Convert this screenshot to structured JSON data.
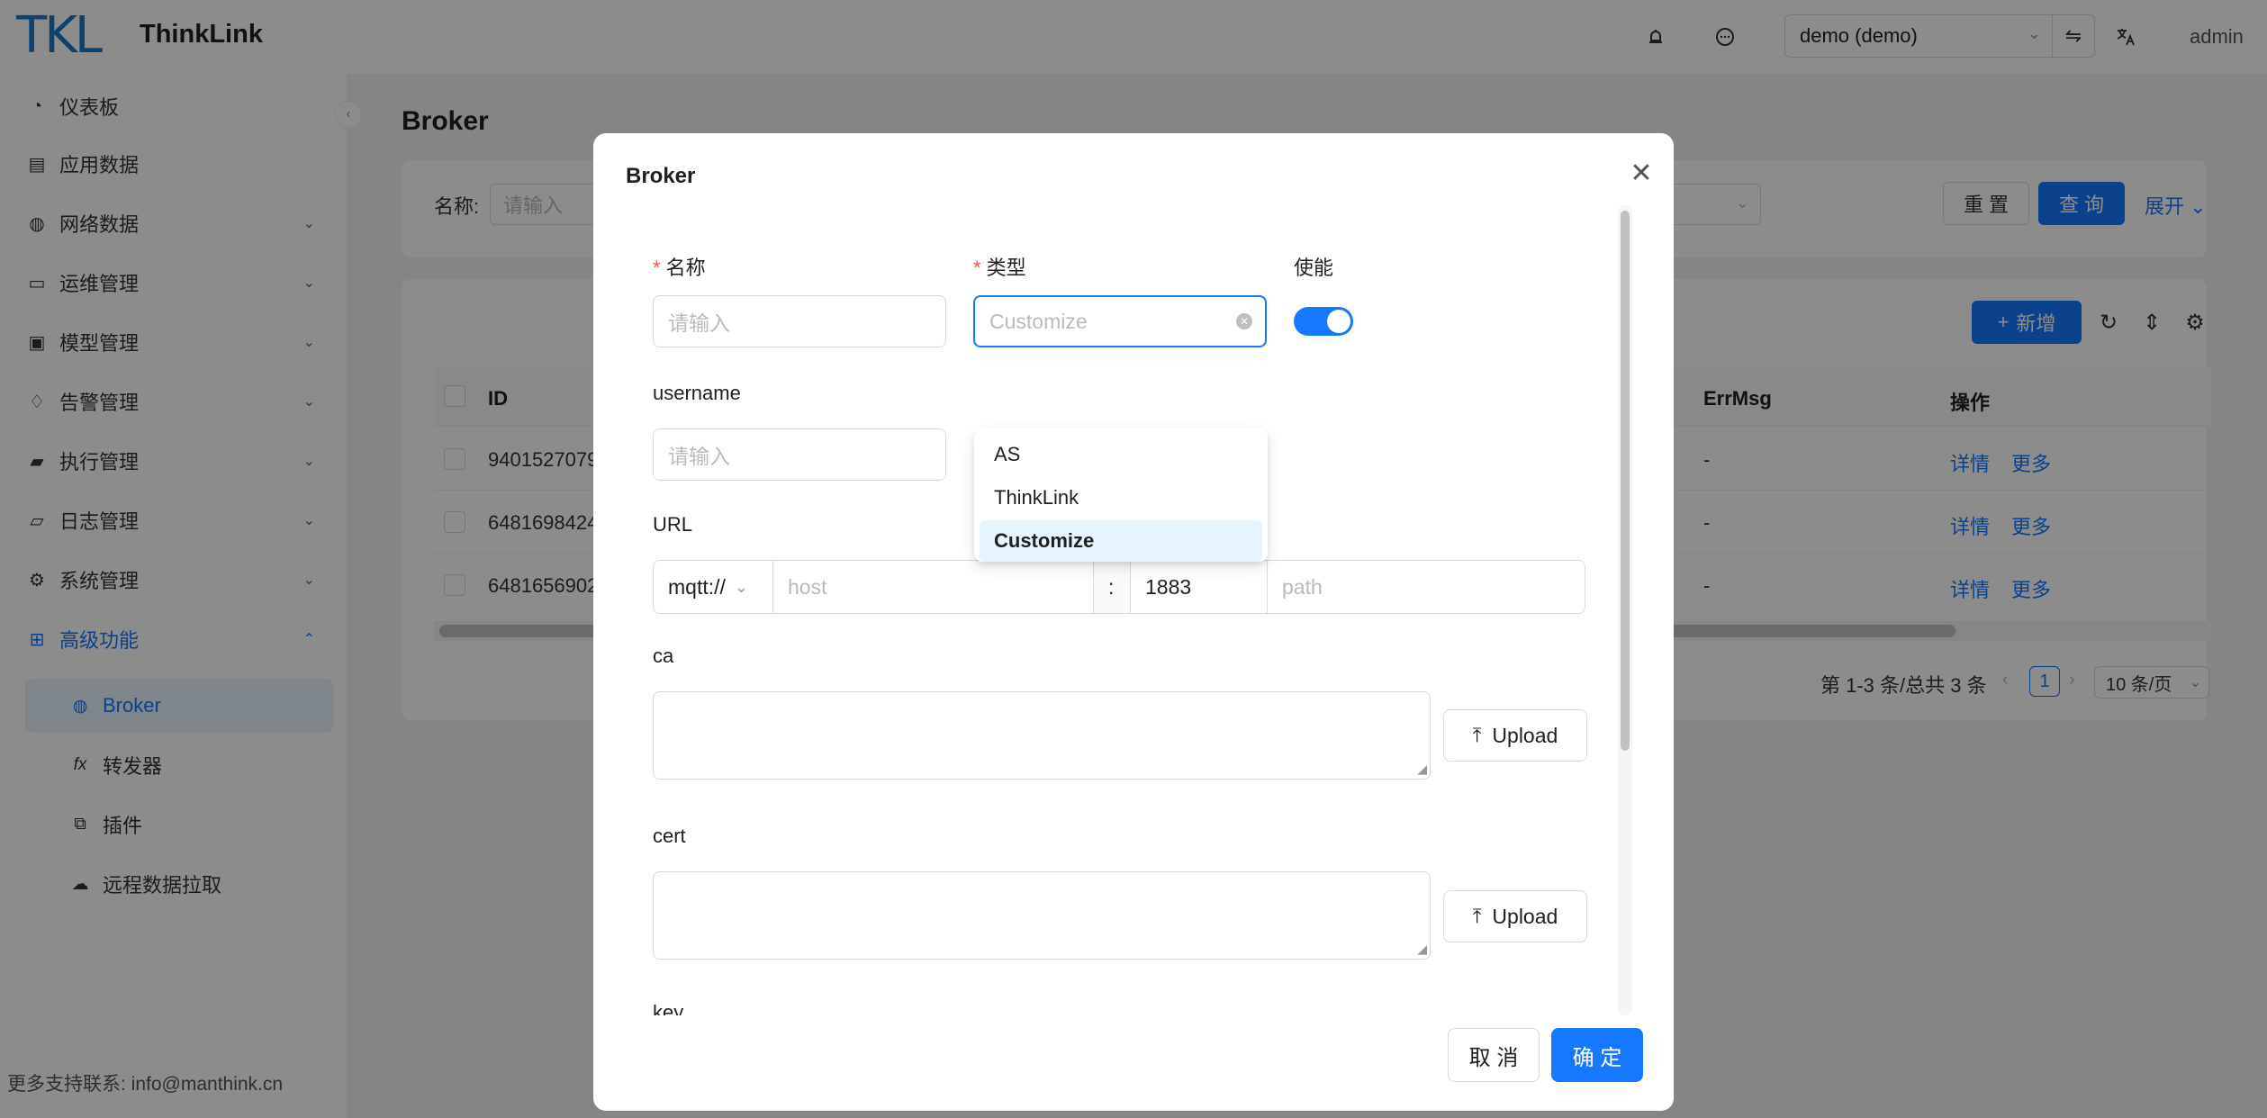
{
  "header": {
    "logo": "TKL",
    "app_name": "ThinkLink",
    "tenant": "demo (demo)",
    "user": "admin",
    "icons": [
      "alarm-icon",
      "message-icon",
      "swap-icon",
      "translate-icon"
    ]
  },
  "sidebar": {
    "items": [
      {
        "label": "仪表板",
        "icon": "dashboard-icon"
      },
      {
        "label": "应用数据",
        "icon": "document-icon"
      },
      {
        "label": "网络数据",
        "icon": "globe-icon"
      },
      {
        "label": "运维管理",
        "icon": "monitor-icon"
      },
      {
        "label": "模型管理",
        "icon": "box-icon"
      },
      {
        "label": "告警管理",
        "icon": "alarm-icon"
      },
      {
        "label": "执行管理",
        "icon": "execute-icon"
      },
      {
        "label": "日志管理",
        "icon": "folder-icon"
      },
      {
        "label": "系统管理",
        "icon": "gear-icon"
      },
      {
        "label": "高级功能",
        "icon": "apps-icon"
      }
    ],
    "sub_items": [
      {
        "label": "Broker",
        "icon": "globe-icon"
      },
      {
        "label": "转发器",
        "icon": "function-icon"
      },
      {
        "label": "插件",
        "icon": "plugin-icon"
      },
      {
        "label": "远程数据拉取",
        "icon": "cloud-download-icon"
      }
    ],
    "footer": "更多支持联系: info@manthink.cn"
  },
  "main": {
    "title": "Broker",
    "search": {
      "name_label": "名称:",
      "name_placeholder": "请输入",
      "reset": "重 置",
      "query": "查 询",
      "expand": "展开"
    },
    "toolbar": {
      "add": "新增"
    },
    "table": {
      "columns": [
        "ID",
        "ErrMsg",
        "操作"
      ],
      "rows": [
        {
          "id": "9401527079",
          "errmsg": "-",
          "detail": "详情",
          "more": "更多"
        },
        {
          "id": "6481698424",
          "errmsg": "-",
          "detail": "详情",
          "more": "更多"
        },
        {
          "id": "6481656902",
          "errmsg": "-",
          "detail": "详情",
          "more": "更多"
        }
      ]
    },
    "pagination": {
      "summary": "第 1-3 条/总共 3 条",
      "current": "1",
      "page_size": "10 条/页"
    }
  },
  "modal": {
    "title": "Broker",
    "name_label": "名称",
    "name_placeholder": "请输入",
    "type_label": "类型",
    "type_value": "Customize",
    "enable_label": "使能",
    "enabled": true,
    "type_options": [
      "AS",
      "ThinkLink",
      "Customize"
    ],
    "selected_option": "Customize",
    "username_label": "username",
    "username_placeholder": "请输入",
    "url_label": "URL",
    "url_scheme": "mqtt://",
    "url_host_placeholder": "host",
    "url_colon": ":",
    "url_port": "1883",
    "url_path_placeholder": "path",
    "ca_label": "ca",
    "cert_label": "cert",
    "key_label": "key",
    "upload_label": "Upload",
    "cancel": "取 消",
    "confirm": "确 定"
  },
  "colors": {
    "primary": "#1677ff",
    "required": "#ff4d4f",
    "selected_bg": "#e6f4ff"
  }
}
